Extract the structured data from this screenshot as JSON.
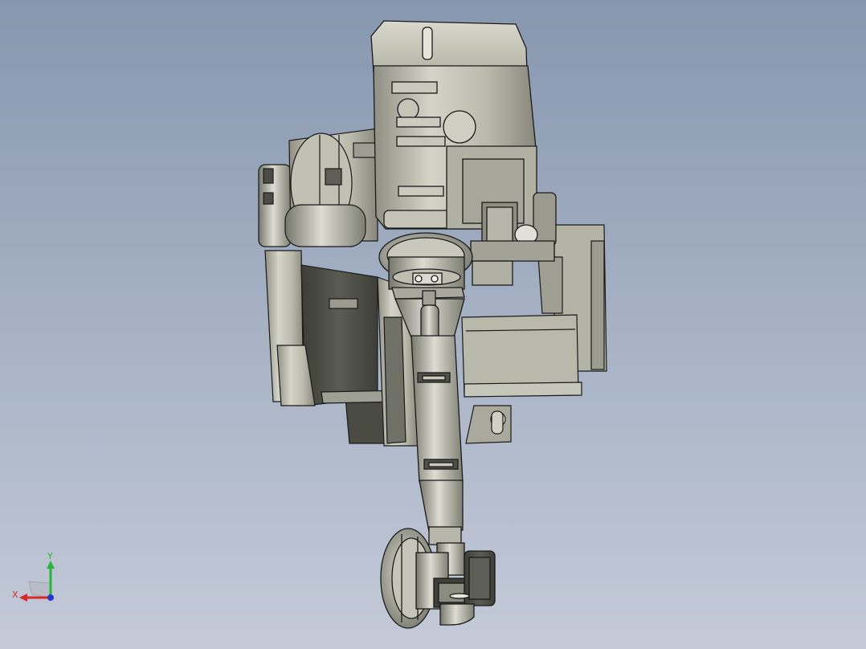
{
  "viewport": {
    "background_top": "#8797af",
    "background_bottom": "#c4cad8",
    "model_body_color": "#b8b8aa",
    "model_shadow_color": "#4a4b43",
    "model_highlight_color": "#e2e2d8",
    "edge_color": "#1a1a1a"
  },
  "triad": {
    "x_label": "X",
    "y_label": "Y",
    "x_color": "#d8282a",
    "y_color": "#2bb43a",
    "z_color": "#2838c8"
  }
}
